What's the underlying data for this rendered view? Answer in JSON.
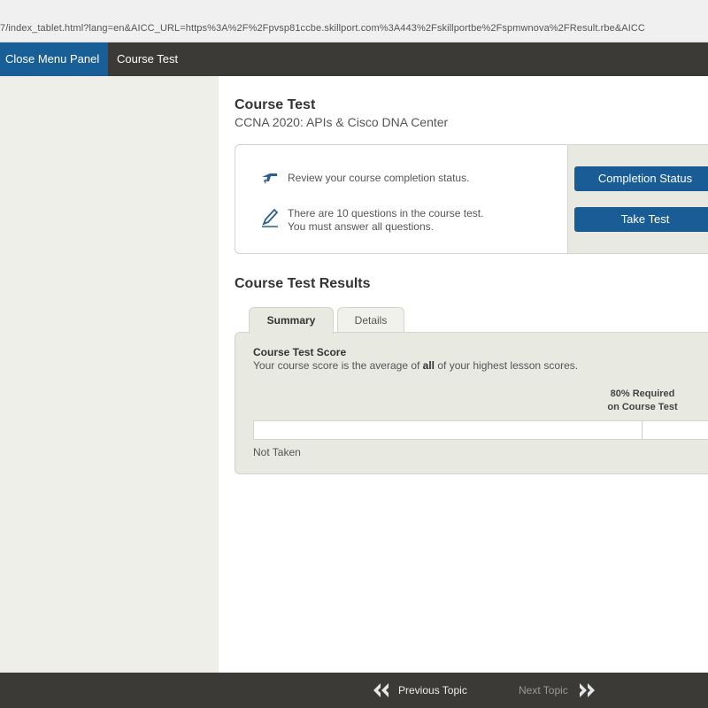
{
  "browser": {
    "url": "7/index_tablet.html?lang=en&AICC_URL=https%3A%2F%2Fpvsp81ccbe.skillport.com%3A443%2Fskillportbe%2Fspmwnova%2FResult.rbe&AICC"
  },
  "topbar": {
    "close_menu_label": "Close Menu Panel",
    "crumb": "Course Test"
  },
  "main": {
    "title": "Course Test",
    "subtitle": "CCNA 2020: APIs & Cisco DNA Center",
    "info": {
      "status_text": "Review your course completion status.",
      "questions_line1": "There are 10 questions in the course test.",
      "questions_line2": "You must answer all questions.",
      "completion_button": "Completion Status",
      "take_test_button": "Take Test"
    },
    "results": {
      "title": "Course Test Results",
      "tabs": [
        {
          "label": "Summary",
          "active": true
        },
        {
          "label": "Details",
          "active": false
        }
      ],
      "score_heading": "Course Test Score",
      "score_desc_before": "Your course score is the average of ",
      "score_desc_bold": "all",
      "score_desc_after": " of your highest lesson scores.",
      "required_line1": "80% Required",
      "required_line2": "on Course Test",
      "required_percent": 80,
      "status": "Not Taken"
    }
  },
  "bottombar": {
    "previous_label": "Previous Topic",
    "next_label": "Next Topic"
  },
  "colors": {
    "accent_blue": "#1a5d96",
    "bar_dark": "#3b3a36",
    "panel_bg": "#e8e9e1"
  }
}
